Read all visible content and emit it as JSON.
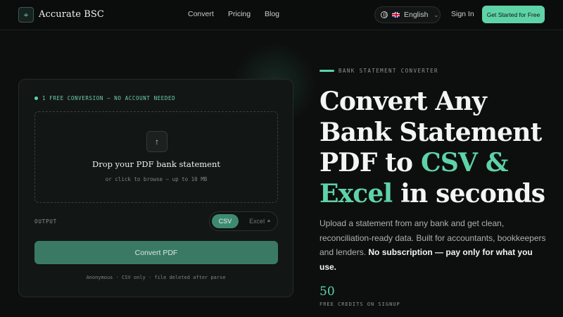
{
  "header": {
    "brand": "Accurate BSC",
    "logo_icon": "crosshair-logo-icon",
    "nav": [
      "Convert",
      "Pricing",
      "Blog"
    ],
    "language": "English",
    "sign_in": "Sign In",
    "cta": "Get Started for Free"
  },
  "converter": {
    "badge": "1 FREE CONVERSION — NO ACCOUNT NEEDED",
    "drop_title": "Drop your PDF bank statement",
    "drop_sub": "or click to browse — up to 10 MB",
    "output_label": "OUTPUT",
    "format_selected": "CSV",
    "format_locked": "Excel",
    "convert_button": "Convert PDF",
    "footnote": "Anonymous · CSV only · file deleted after parse"
  },
  "hero": {
    "eyebrow": "BANK STATEMENT CONVERTER",
    "headline_part1": "Convert Any Bank Statement PDF to ",
    "headline_hl1": "CSV &",
    "headline_hl2": "Excel",
    "headline_part2": " in seconds",
    "description": "Upload a statement from any bank and get clean, reconciliation-ready data. Built for accountants, bookkeepers and lenders. ",
    "description_bold": "No subscription — pay only for what you use.",
    "stat_value": "50",
    "stat_label": "FREE CREDITS ON SIGNUP"
  },
  "colors": {
    "accent": "#5fd3a8",
    "background": "#0d0f0f",
    "card": "#121615",
    "button": "#3a7a64"
  }
}
